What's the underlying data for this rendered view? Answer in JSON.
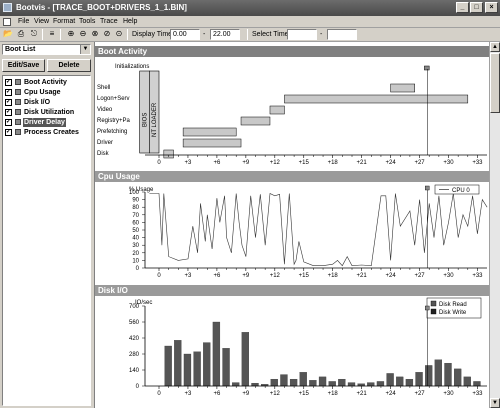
{
  "window": {
    "title": "Bootvis - [TRACE_BOOT+DRIVERS_1_1.BIN]",
    "minimize": "_",
    "restore": "□",
    "close": "×"
  },
  "menu": [
    "File",
    "View",
    "Format",
    "Tools",
    "Trace",
    "Help"
  ],
  "toolbar": {
    "display_time_label": "Display Time",
    "display_start": "0.00",
    "dash": "-",
    "display_end": "22.00",
    "select_time_label": "Select Time",
    "select_start": "",
    "select_end": "",
    "icons": [
      "open-icon",
      "print-icon",
      "print-preview-icon",
      "list-icon",
      "zoom-in-icon",
      "zoom-out-icon",
      "zoom-fit-icon",
      "zoom-select-icon",
      "zoom-reset-icon"
    ]
  },
  "left": {
    "combo_value": "Boot List",
    "edit_save": "Edit/Save",
    "delete": "Delete",
    "items": [
      {
        "label": "Boot Activity",
        "checked": true,
        "selected": false
      },
      {
        "label": "Cpu Usage",
        "checked": true,
        "selected": false
      },
      {
        "label": "Disk I/O",
        "checked": true,
        "selected": false
      },
      {
        "label": "Disk Utilization",
        "checked": true,
        "selected": false
      },
      {
        "label": "Driver Delay",
        "checked": true,
        "selected": true
      },
      {
        "label": "Process Creates",
        "checked": true,
        "selected": false
      }
    ]
  },
  "panels": {
    "boot": {
      "title": "Boot Activity",
      "top_label": "Initializations",
      "rows": [
        "Shell",
        "Logon+Serv",
        "Video",
        "Registry+Pa",
        "Prefetching",
        "Driver",
        "Disk"
      ],
      "bios_label": "BIOS",
      "ntloader_label": "NT LOADER"
    },
    "cpu": {
      "title": "Cpu Usage",
      "ylabel": "% Usage",
      "legend": "CPU 0",
      "yticks": [
        "100",
        "90",
        "80",
        "70",
        "60",
        "50",
        "40",
        "30",
        "20",
        "10",
        "0"
      ]
    },
    "disk": {
      "title": "Disk I/O",
      "ylabel": "IO/sec",
      "legend": [
        "Disk Read",
        "Disk Write"
      ],
      "yticks": [
        "700",
        "560",
        "420",
        "280",
        "140",
        "0"
      ]
    }
  },
  "xticks": [
    "0",
    "+3",
    "+6",
    "+9",
    "+12",
    "+15",
    "+18",
    "+21",
    "+24",
    "+27",
    "+30",
    "+33"
  ],
  "chart_data": [
    {
      "type": "bar",
      "title": "Boot Activity",
      "xlabel": "",
      "ylabel": "",
      "xlim": [
        0,
        33
      ],
      "ranges": [
        {
          "label": "Initializations",
          "start": 27.5,
          "end": 28.0
        },
        {
          "label": "Shell",
          "start": 24.0,
          "end": 26.5
        },
        {
          "label": "Logon+Serv",
          "start": 13.0,
          "end": 32.0
        },
        {
          "label": "Video",
          "start": 11.5,
          "end": 13.0
        },
        {
          "label": "Registry+Pa",
          "start": 8.5,
          "end": 11.5
        },
        {
          "label": "Prefetching",
          "start": 2.5,
          "end": 8.0
        },
        {
          "label": "Driver",
          "start": 2.5,
          "end": 8.5
        },
        {
          "label": "Disk",
          "start": 0.5,
          "end": 1.5
        }
      ],
      "markers": [
        {
          "label": "BIOS",
          "start": -2.0,
          "end": -1.0
        },
        {
          "label": "NT LOADER",
          "start": -1.0,
          "end": 0.0
        }
      ]
    },
    {
      "type": "line",
      "title": "Cpu Usage",
      "ylabel": "% Usage",
      "ylim": [
        0,
        100
      ],
      "xlim": [
        -1,
        34
      ],
      "series": [
        {
          "name": "CPU 0",
          "x": [
            -1,
            0,
            0.3,
            0.5,
            1,
            2,
            3,
            3.5,
            4,
            4.3,
            4.8,
            5,
            5.5,
            6,
            6.3,
            6.8,
            7,
            7.5,
            8,
            8.3,
            8.6,
            9,
            9.5,
            10,
            10.5,
            11,
            11.5,
            12,
            12.5,
            13,
            13.5,
            14,
            14.2,
            14.5,
            15,
            16,
            17,
            18,
            18.5,
            19,
            19.5,
            20,
            21,
            22,
            23,
            23.5,
            24,
            24.5,
            25,
            26,
            26.5,
            27,
            27.5,
            28,
            28.5,
            29,
            29.5,
            30,
            30.5,
            31,
            31.5,
            32,
            32.5,
            33,
            33.5,
            34
          ],
          "y": [
            98,
            98,
            30,
            98,
            15,
            10,
            12,
            55,
            20,
            85,
            35,
            70,
            25,
            92,
            60,
            95,
            40,
            20,
            98,
            60,
            30,
            15,
            95,
            40,
            97,
            30,
            98,
            95,
            97,
            5,
            98,
            5,
            10,
            35,
            8,
            3,
            3,
            5,
            10,
            3,
            15,
            3,
            4,
            3,
            95,
            95,
            10,
            98,
            55,
            75,
            30,
            90,
            20,
            85,
            40,
            95,
            30,
            60,
            98,
            40,
            70,
            55,
            95,
            45,
            90,
            80
          ]
        }
      ]
    },
    {
      "type": "bar",
      "title": "Disk I/O",
      "ylabel": "IO/sec",
      "ylim": [
        0,
        700
      ],
      "series": [
        {
          "name": "Disk Read",
          "x": [
            1,
            2,
            3,
            4,
            5,
            6,
            7,
            8,
            9,
            10,
            11,
            12,
            13,
            14,
            15,
            16,
            17,
            18,
            19,
            20,
            21,
            22,
            23,
            24,
            25,
            26,
            27,
            28,
            29,
            30,
            31,
            32,
            33
          ],
          "values": [
            350,
            400,
            280,
            300,
            380,
            560,
            330,
            30,
            470,
            25,
            15,
            60,
            100,
            60,
            120,
            50,
            80,
            40,
            60,
            30,
            20,
            30,
            40,
            110,
            80,
            60,
            120,
            180,
            230,
            200,
            150,
            80,
            40
          ]
        },
        {
          "name": "Disk Write",
          "x": [
            1,
            2,
            3,
            4,
            5,
            6,
            7,
            8,
            9,
            10,
            11,
            12,
            13,
            14,
            15,
            16,
            17,
            18,
            19,
            20,
            21,
            22,
            23,
            24,
            25,
            26,
            27,
            28,
            29,
            30,
            31,
            32,
            33
          ],
          "values": [
            0,
            0,
            0,
            0,
            0,
            0,
            0,
            0,
            0,
            0,
            0,
            0,
            0,
            0,
            0,
            0,
            0,
            0,
            0,
            0,
            0,
            0,
            0,
            0,
            0,
            0,
            0,
            0,
            0,
            0,
            0,
            0,
            0
          ]
        }
      ]
    }
  ]
}
